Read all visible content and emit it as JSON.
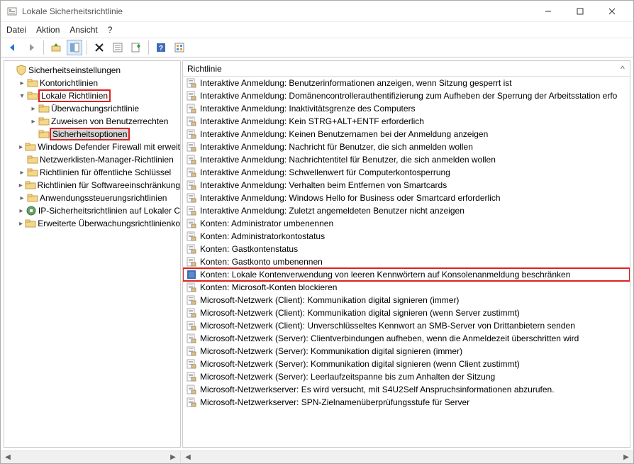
{
  "window": {
    "title": "Lokale Sicherheitsrichtlinie"
  },
  "menu": {
    "file": "Datei",
    "action": "Aktion",
    "view": "Ansicht",
    "help": "?"
  },
  "tree": {
    "root": "Sicherheitseinstellungen",
    "items": [
      {
        "label": "Kontorichtlinien",
        "depth": 1,
        "expander": ">",
        "folder": true
      },
      {
        "label": "Lokale Richtlinien",
        "depth": 1,
        "expander": "v",
        "folder": true,
        "highlighted": true
      },
      {
        "label": "Überwachungsrichtlinie",
        "depth": 2,
        "expander": ">",
        "folder": true
      },
      {
        "label": "Zuweisen von Benutzerrechten",
        "depth": 2,
        "expander": ">",
        "folder": true
      },
      {
        "label": "Sicherheitsoptionen",
        "depth": 2,
        "expander": "",
        "folder": true,
        "highlighted": true,
        "selected": true
      },
      {
        "label": "Windows Defender Firewall mit erweit",
        "depth": 1,
        "expander": ">",
        "folder": true
      },
      {
        "label": "Netzwerklisten-Manager-Richtlinien",
        "depth": 1,
        "expander": "",
        "folder": true
      },
      {
        "label": "Richtlinien für öffentliche Schlüssel",
        "depth": 1,
        "expander": ">",
        "folder": true
      },
      {
        "label": "Richtlinien für Softwareeinschränkung",
        "depth": 1,
        "expander": ">",
        "folder": true
      },
      {
        "label": "Anwendungssteuerungsrichtlinien",
        "depth": 1,
        "expander": ">",
        "folder": true
      },
      {
        "label": "IP-Sicherheitsrichtlinien auf Lokaler C",
        "depth": 1,
        "expander": ">",
        "ipsec": true
      },
      {
        "label": "Erweiterte Überwachungsrichtlinienko",
        "depth": 1,
        "expander": ">",
        "folder": true
      }
    ]
  },
  "list": {
    "header": "Richtlinie",
    "rows": [
      {
        "label": "Interaktive Anmeldung: Benutzerinformationen anzeigen, wenn Sitzung gesperrt ist"
      },
      {
        "label": "Interaktive Anmeldung: Domänencontrollerauthentifizierung zum Aufheben der Sperrung der Arbeitsstation erfo"
      },
      {
        "label": "Interaktive Anmeldung: Inaktivitätsgrenze des Computers"
      },
      {
        "label": "Interaktive Anmeldung: Kein STRG+ALT+ENTF erforderlich"
      },
      {
        "label": "Interaktive Anmeldung: Keinen Benutzernamen bei der Anmeldung anzeigen"
      },
      {
        "label": "Interaktive Anmeldung: Nachricht für Benutzer, die sich anmelden wollen"
      },
      {
        "label": "Interaktive Anmeldung: Nachrichtentitel für Benutzer, die sich anmelden wollen"
      },
      {
        "label": "Interaktive Anmeldung: Schwellenwert für Computerkontosperrung"
      },
      {
        "label": "Interaktive Anmeldung: Verhalten beim Entfernen von Smartcards"
      },
      {
        "label": "Interaktive Anmeldung: Windows Hello for Business oder Smartcard erforderlich"
      },
      {
        "label": "Interaktive Anmeldung: Zuletzt angemeldeten Benutzer nicht anzeigen"
      },
      {
        "label": "Konten: Administrator umbenennen"
      },
      {
        "label": "Konten: Administratorkontostatus"
      },
      {
        "label": "Konten: Gastkontenstatus"
      },
      {
        "label": "Konten: Gastkonto umbenennen"
      },
      {
        "label": "Konten: Lokale Kontenverwendung von leeren Kennwörtern auf Konsolenanmeldung beschränken",
        "highlighted": true,
        "selected": true
      },
      {
        "label": "Konten: Microsoft-Konten blockieren"
      },
      {
        "label": "Microsoft-Netzwerk (Client): Kommunikation digital signieren (immer)"
      },
      {
        "label": "Microsoft-Netzwerk (Client): Kommunikation digital signieren (wenn Server zustimmt)"
      },
      {
        "label": "Microsoft-Netzwerk (Client): Unverschlüsseltes Kennwort an SMB-Server von Drittanbietern senden"
      },
      {
        "label": "Microsoft-Netzwerk (Server): Clientverbindungen aufheben, wenn die Anmeldezeit überschritten wird"
      },
      {
        "label": "Microsoft-Netzwerk (Server): Kommunikation digital signieren (immer)"
      },
      {
        "label": "Microsoft-Netzwerk (Server): Kommunikation digital signieren (wenn Client zustimmt)"
      },
      {
        "label": "Microsoft-Netzwerk (Server): Leerlaufzeitspanne bis zum Anhalten der Sitzung"
      },
      {
        "label": "Microsoft-Netzwerkserver: Es wird versucht, mit S4U2Self Anspruchsinformationen abzurufen."
      },
      {
        "label": "Microsoft-Netzwerkserver: SPN-Zielnamenüberprüfungsstufe für Server"
      }
    ]
  }
}
